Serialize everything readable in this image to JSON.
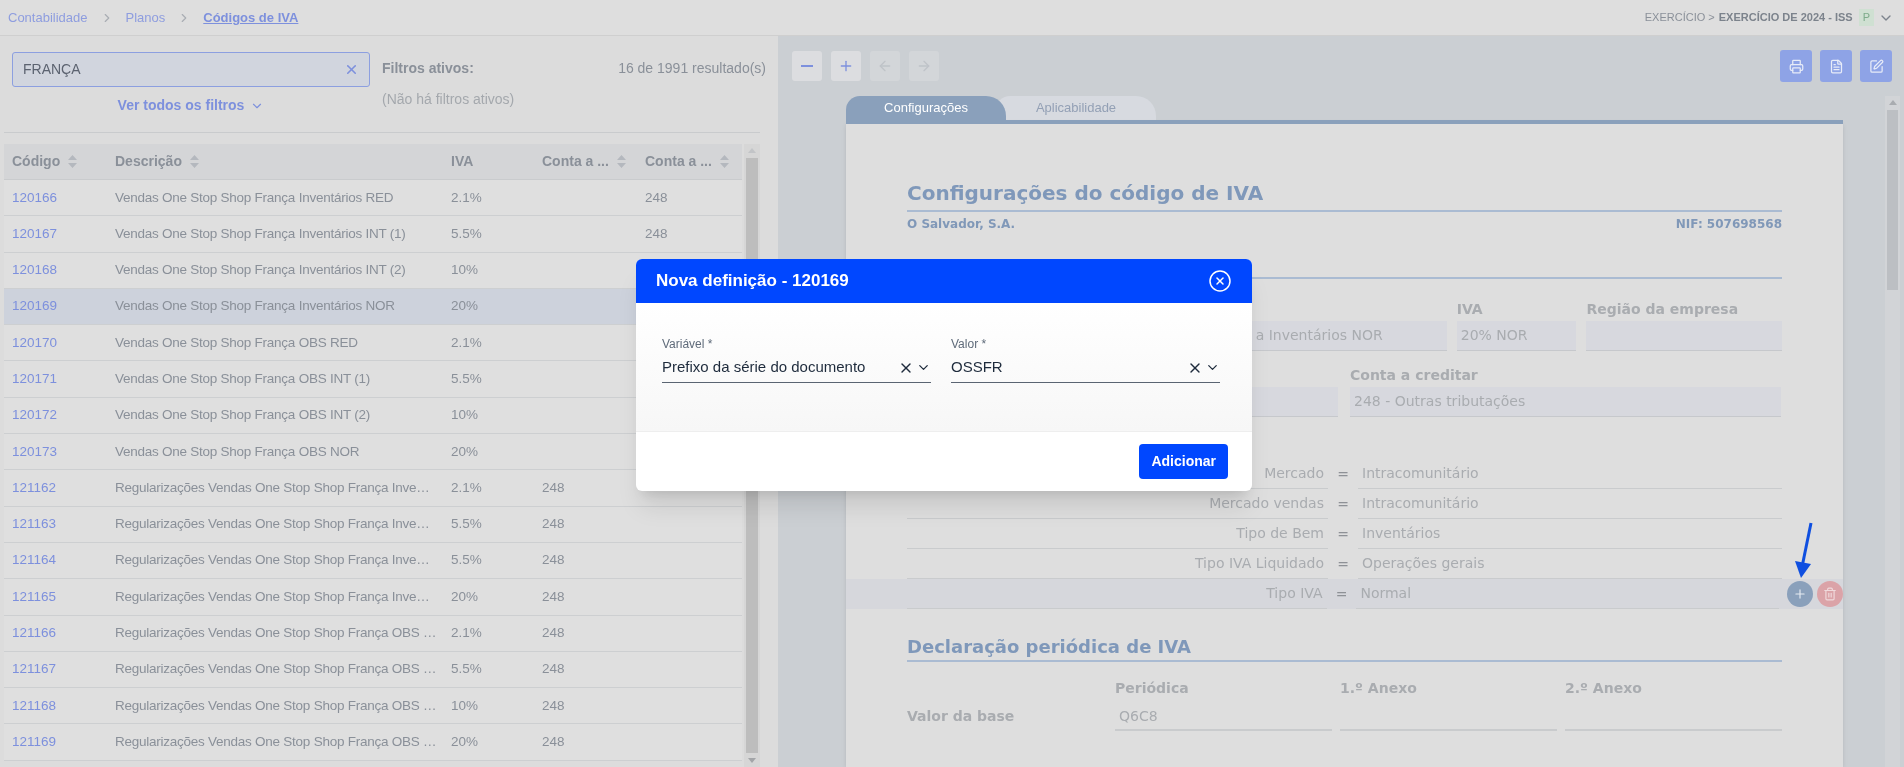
{
  "breadcrumb": [
    {
      "label": "Contabilidade",
      "current": false
    },
    {
      "label": "Planos",
      "current": false
    },
    {
      "label": "Códigos de IVA",
      "current": true
    }
  ],
  "exercise": {
    "prefix": "EXERCÍCIO >",
    "name": "EXERCÍCIO DE 2024 - ISS",
    "badge": "P"
  },
  "search": {
    "value": "FRANÇA"
  },
  "filters_toggle": "Ver todos os filtros",
  "active_filters": {
    "title": "Filtros ativos:",
    "empty": "(Não há filtros ativos)"
  },
  "result_count": "16 de 1991 resultado(s)",
  "table": {
    "columns": [
      {
        "label": "Código",
        "sortable": true
      },
      {
        "label": "Descrição",
        "sortable": true
      },
      {
        "label": "IVA",
        "sortable": false
      },
      {
        "label": "Conta a ...",
        "sortable": true
      },
      {
        "label": "Conta a ...",
        "sortable": true
      }
    ],
    "rows": [
      {
        "code": "120166",
        "description": "Vendas One Stop Shop França Inventários RED",
        "iva": "2.1%",
        "column_4": "",
        "column_5": "248",
        "selected": false
      },
      {
        "code": "120167",
        "description": "Vendas One Stop Shop França Inventários INT (1)",
        "iva": "5.5%",
        "column_4": "",
        "column_5": "248",
        "selected": false
      },
      {
        "code": "120168",
        "description": "Vendas One Stop Shop França Inventários INT (2)",
        "iva": "10%",
        "column_4": "",
        "column_5": "",
        "selected": false
      },
      {
        "code": "120169",
        "description": "Vendas One Stop Shop França Inventários NOR",
        "iva": "20%",
        "column_4": "",
        "column_5": "",
        "selected": true
      },
      {
        "code": "120170",
        "description": "Vendas One Stop Shop França OBS RED",
        "iva": "2.1%",
        "column_4": "",
        "column_5": "",
        "selected": false
      },
      {
        "code": "120171",
        "description": "Vendas One Stop Shop França OBS INT (1)",
        "iva": "5.5%",
        "column_4": "",
        "column_5": "",
        "selected": false
      },
      {
        "code": "120172",
        "description": "Vendas One Stop Shop França OBS INT (2)",
        "iva": "10%",
        "column_4": "",
        "column_5": "",
        "selected": false
      },
      {
        "code": "120173",
        "description": "Vendas One Stop Shop França OBS NOR",
        "iva": "20%",
        "column_4": "",
        "column_5": "",
        "selected": false
      },
      {
        "code": "121162",
        "description": "Regularizações Vendas One Stop Shop França Inve…",
        "iva": "2.1%",
        "column_4": "248",
        "column_5": "",
        "selected": false
      },
      {
        "code": "121163",
        "description": "Regularizações Vendas One Stop Shop França Inve…",
        "iva": "5.5%",
        "column_4": "248",
        "column_5": "",
        "selected": false
      },
      {
        "code": "121164",
        "description": "Regularizações Vendas One Stop Shop França Inve…",
        "iva": "5.5%",
        "column_4": "248",
        "column_5": "",
        "selected": false
      },
      {
        "code": "121165",
        "description": "Regularizações Vendas One Stop Shop França Inve…",
        "iva": "20%",
        "column_4": "248",
        "column_5": "",
        "selected": false
      },
      {
        "code": "121166",
        "description": "Regularizações Vendas One Stop Shop França OBS …",
        "iva": "2.1%",
        "column_4": "248",
        "column_5": "",
        "selected": false
      },
      {
        "code": "121167",
        "description": "Regularizações Vendas One Stop Shop França OBS …",
        "iva": "5.5%",
        "column_4": "248",
        "column_5": "",
        "selected": false
      },
      {
        "code": "121168",
        "description": "Regularizações Vendas One Stop Shop França OBS …",
        "iva": "10%",
        "column_4": "248",
        "column_5": "",
        "selected": false
      },
      {
        "code": "121169",
        "description": "Regularizações Vendas One Stop Shop França OBS …",
        "iva": "20%",
        "column_4": "248",
        "column_5": "",
        "selected": false
      }
    ]
  },
  "toolbar": [
    {
      "kind": "zoom-out",
      "disabled": false
    },
    {
      "kind": "zoom-in",
      "disabled": false
    },
    {
      "kind": "back",
      "disabled": true
    },
    {
      "kind": "forward",
      "disabled": true
    }
  ],
  "actions": [
    {
      "kind": "print"
    },
    {
      "kind": "pdf"
    },
    {
      "kind": "edit"
    }
  ],
  "tabs": [
    {
      "label": "Configurações",
      "selected": true
    },
    {
      "label": "Aplicabilidade",
      "selected": false
    }
  ],
  "document": {
    "title": "Configurações do código de IVA",
    "company": "O Salvador, S.A.",
    "nif": "NIF: 507698568",
    "fields_row_1": [
      {
        "value": "a Inventários NOR"
      },
      {
        "label": "IVA",
        "value": "20% NOR"
      },
      {
        "label": "Região da empresa"
      }
    ],
    "fields_row_2": [
      {
        "label": "Conta a creditar",
        "value": "248 - Outras tributações"
      }
    ],
    "rules": [
      {
        "label": "Mercado",
        "operator": "=",
        "value": "Intracomunitário",
        "selected": false
      },
      {
        "label": "Mercado vendas",
        "operator": "=",
        "value": "Intracomunitário",
        "selected": false
      },
      {
        "label": "Tipo de Bem",
        "operator": "=",
        "value": "Inventários",
        "selected": false
      },
      {
        "label": "Tipo IVA Liquidado",
        "operator": "=",
        "value": "Operações gerais",
        "selected": false
      },
      {
        "label": "Tipo IVA",
        "operator": "=",
        "value": "Normal",
        "selected": true
      }
    ],
    "declaration": {
      "title": "Declaração periódica de IVA",
      "columns": [
        "Periódica",
        "1.º Anexo",
        "2.º Anexo"
      ],
      "rows": [
        {
          "label": "Valor da base",
          "values": [
            "Q6C8"
          ]
        }
      ]
    }
  },
  "modal": {
    "title": "Nova definição - 120169",
    "fields": [
      {
        "label": "Variável *",
        "value": "Prefixo da série do documento"
      },
      {
        "label": "Valor *",
        "value": "OSSFR"
      }
    ],
    "button": "Adicionar"
  }
}
